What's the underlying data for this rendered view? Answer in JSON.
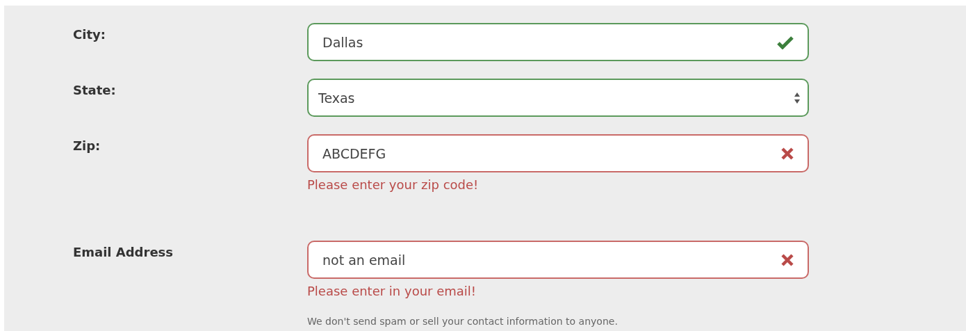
{
  "address": [
    {
      "label": "City:",
      "kind": "input",
      "value": "Dallas",
      "valid": true
    },
    {
      "label": "State:",
      "kind": "select",
      "value": "Texas",
      "valid": true
    },
    {
      "label": "Zip:",
      "kind": "input",
      "value": "ABCDEFG",
      "valid": false,
      "error": "Please enter your zip code!"
    }
  ],
  "email": {
    "label": "Email Address",
    "kind": "input",
    "value": "not an email",
    "valid": false,
    "error": "Please enter in your email!",
    "help": "We don't send spam or sell your contact information to anyone."
  }
}
